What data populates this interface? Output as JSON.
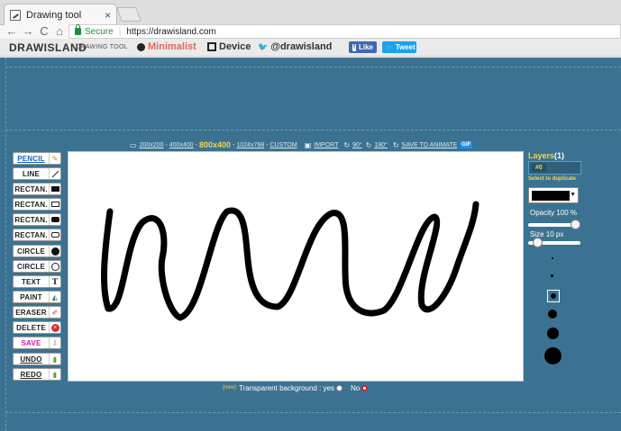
{
  "browser": {
    "tab_title": "Drawing tool",
    "tab_close": "×",
    "secure_label": "Secure",
    "url": "https://drawisland.com",
    "nav": {
      "back": "←",
      "forward": "→",
      "reload": "C",
      "home": "⌂"
    }
  },
  "header": {
    "brand": "DRAWISLAND",
    "subtitle": "DRAWING TOOL",
    "links": {
      "minimalist": "Minimalist",
      "device": "Device",
      "twitter": "@drawisland"
    },
    "fb_like": "Like",
    "tweet": "Tweet"
  },
  "size_bar": {
    "options": [
      "200x200",
      "400x400"
    ],
    "current": "800x400",
    "custom_options": [
      "1024x768",
      "CUSTOM"
    ],
    "import_label": "IMPORT",
    "rotate_cw": "90°",
    "rotate_180": "180°",
    "animate_label": "SAVE TO ANIMATE",
    "gif_badge": "GIF"
  },
  "tools": [
    {
      "label": "PENCIL",
      "icon": "pencil-icon"
    },
    {
      "label": "LINE",
      "icon": "line-icon"
    },
    {
      "label": "RECTAN.",
      "icon": "rect-filled-icon"
    },
    {
      "label": "RECTAN.",
      "icon": "rect-outline-icon"
    },
    {
      "label": "RECTAN.",
      "icon": "rounded-rect-filled-icon"
    },
    {
      "label": "RECTAN.",
      "icon": "rounded-rect-outline-icon"
    },
    {
      "label": "CIRCLE",
      "icon": "circle-filled-icon"
    },
    {
      "label": "CIRCLE",
      "icon": "circle-outline-icon"
    },
    {
      "label": "TEXT",
      "icon": "text-icon"
    },
    {
      "label": "PAINT",
      "icon": "paint-bucket-icon"
    },
    {
      "label": "ERASER",
      "icon": "eraser-icon"
    },
    {
      "label": "DELETE",
      "icon": "delete-icon"
    },
    {
      "label": "SAVE",
      "icon": "save-icon"
    },
    {
      "label": "UNDO",
      "icon": "undo-icon"
    },
    {
      "label": "REDO",
      "icon": "redo-icon"
    }
  ],
  "transparent": {
    "new_tag": "(new)",
    "label": "Transparent background : yes",
    "no_label": "No",
    "selected": "no"
  },
  "layers": {
    "title": "Layers",
    "count": "(1)",
    "items": [
      "#0"
    ],
    "duplicate_hint": "Select to duplicate"
  },
  "brush": {
    "color": "#000000",
    "opacity_label": "Opacity",
    "opacity_value": "100 %",
    "opacity_fraction": 1.0,
    "size_label": "Size",
    "size_value": "10 px",
    "size_fraction": 0.1
  },
  "colors": {
    "workspace": "#3c7291",
    "accent_yellow": "#f3d54a",
    "brand_red": "#e06a5c"
  }
}
